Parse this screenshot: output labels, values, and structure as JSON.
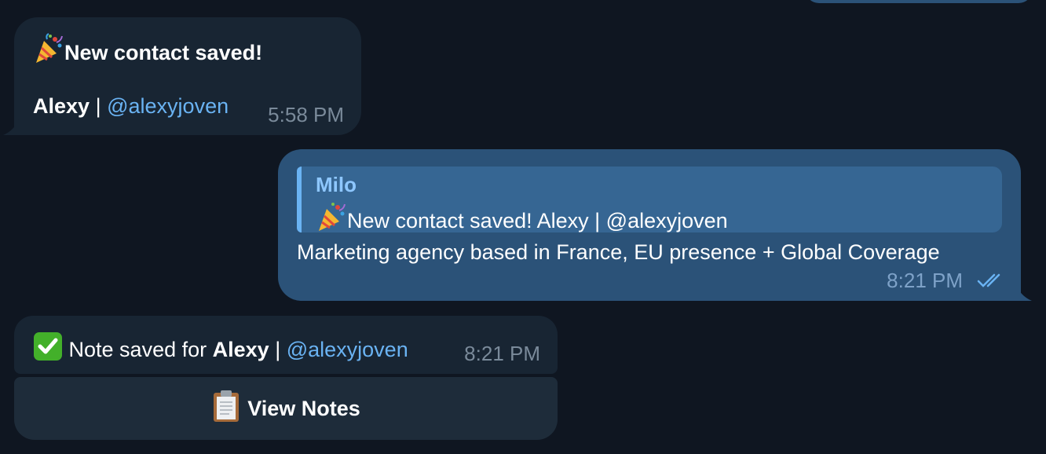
{
  "messages": {
    "contact_saved": {
      "title": "New contact saved!",
      "icon": "party-popper-icon",
      "name": "Alexy",
      "separator": "|",
      "username": "@alexyjoven",
      "time": "5:58 PM"
    },
    "reply": {
      "quoted_author": "Milo",
      "quoted_icon": "party-popper-icon",
      "quoted_text": "New contact saved!  Alexy | @alexyjoven",
      "text": "Marketing agency based in France, EU presence + Global Coverage",
      "time": "8:21 PM",
      "status_icon": "double-check-icon"
    },
    "note_saved": {
      "icon": "check-mark-button-icon",
      "prefix": "Note saved for ",
      "name": "Alexy",
      "separator": "|",
      "username": "@alexyjoven",
      "time": "8:21 PM"
    }
  },
  "keyboard": {
    "view_notes_icon": "clipboard-icon",
    "view_notes_label": "View Notes"
  },
  "colors": {
    "background": "#0f1621",
    "incoming_bubble": "#182533",
    "outgoing_bubble": "#2b5278",
    "link": "#6ab3f3",
    "reply_author": "#8ec7ff"
  }
}
